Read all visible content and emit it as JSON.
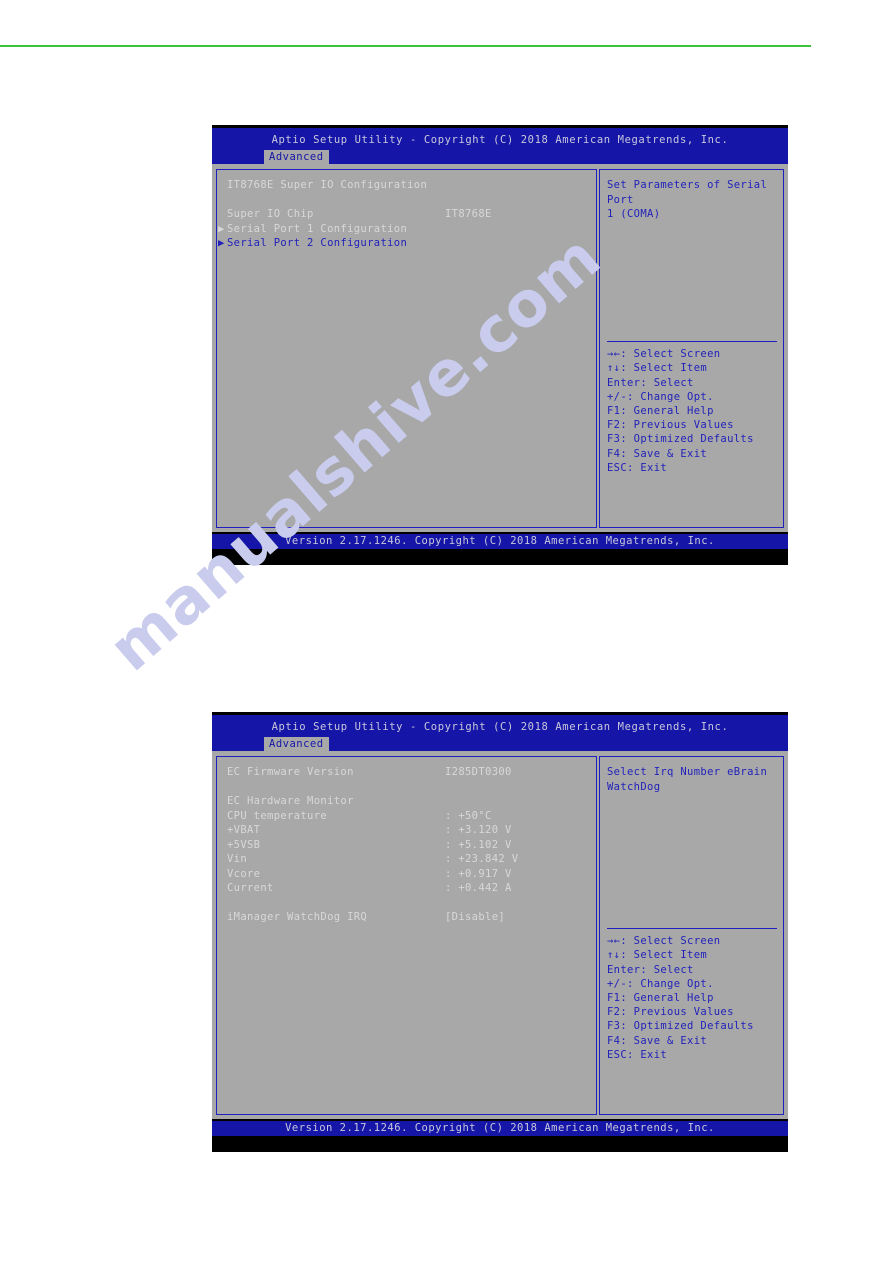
{
  "page": {
    "watermark": "manualshive.com",
    "rule_color": "#3cc13c"
  },
  "screens": [
    {
      "id": "super-io-configuration",
      "title": "Aptio Setup Utility - Copyright (C) 2018 American Megatrends, Inc.",
      "tab": "Advanced",
      "section_heading": "IT8768E Super IO Configuration",
      "items": [
        {
          "label": "Super IO Chip",
          "value": "IT8768E",
          "arrow": false,
          "selected": true
        },
        {
          "label": "Serial Port 1 Configuration",
          "value": "",
          "arrow": true,
          "selected": true
        },
        {
          "label": "Serial Port 2 Configuration",
          "value": "",
          "arrow": true,
          "selected": false
        }
      ],
      "help": "Set Parameters of Serial Port\n1 (COMA)",
      "legend": [
        "→←: Select Screen",
        "↑↓: Select Item",
        "Enter: Select",
        "+/-: Change Opt.",
        "F1: General Help",
        "F2: Previous Values",
        "F3: Optimized Defaults",
        "F4: Save & Exit",
        "ESC: Exit"
      ],
      "footer": "Version 2.17.1246. Copyright (C) 2018 American Megatrends, Inc."
    },
    {
      "id": "ec-hardware-monitor",
      "title": "Aptio Setup Utility - Copyright (C) 2018 American Megatrends, Inc.",
      "tab": "Advanced",
      "section_heading": "",
      "items": [
        {
          "label": "EC Firmware Version",
          "value": "I285DT0300",
          "arrow": false,
          "selected": false
        },
        {
          "label": "",
          "value": "",
          "spacer": true
        },
        {
          "label": "EC Hardware Monitor",
          "value": "",
          "arrow": false,
          "selected": false
        },
        {
          "label": "CPU temperature",
          "value": ": +50°C",
          "arrow": false,
          "selected": false
        },
        {
          "label": "+VBAT",
          "value": ": +3.120 V",
          "arrow": false,
          "selected": false
        },
        {
          "label": "+5VSB",
          "value": ": +5.102 V",
          "arrow": false,
          "selected": false
        },
        {
          "label": "Vin",
          "value": ": +23.842 V",
          "arrow": false,
          "selected": false
        },
        {
          "label": "Vcore",
          "value": ": +0.917 V",
          "arrow": false,
          "selected": false
        },
        {
          "label": "Current",
          "value": ": +0.442 A",
          "arrow": false,
          "selected": false
        },
        {
          "label": "",
          "value": "",
          "spacer": true
        },
        {
          "label": "iManager WatchDog IRQ",
          "value": "[Disable]",
          "arrow": false,
          "selected": false
        }
      ],
      "help": "Select Irq Number eBrain\nWatchDog",
      "legend": [
        "→←: Select Screen",
        "↑↓: Select Item",
        "Enter: Select",
        "+/-: Change Opt.",
        "F1: General Help",
        "F2: Previous Values",
        "F3: Optimized Defaults",
        "F4: Save & Exit",
        "ESC: Exit"
      ],
      "footer": "Version 2.17.1246. Copyright (C) 2018 American Megatrends, Inc."
    }
  ]
}
